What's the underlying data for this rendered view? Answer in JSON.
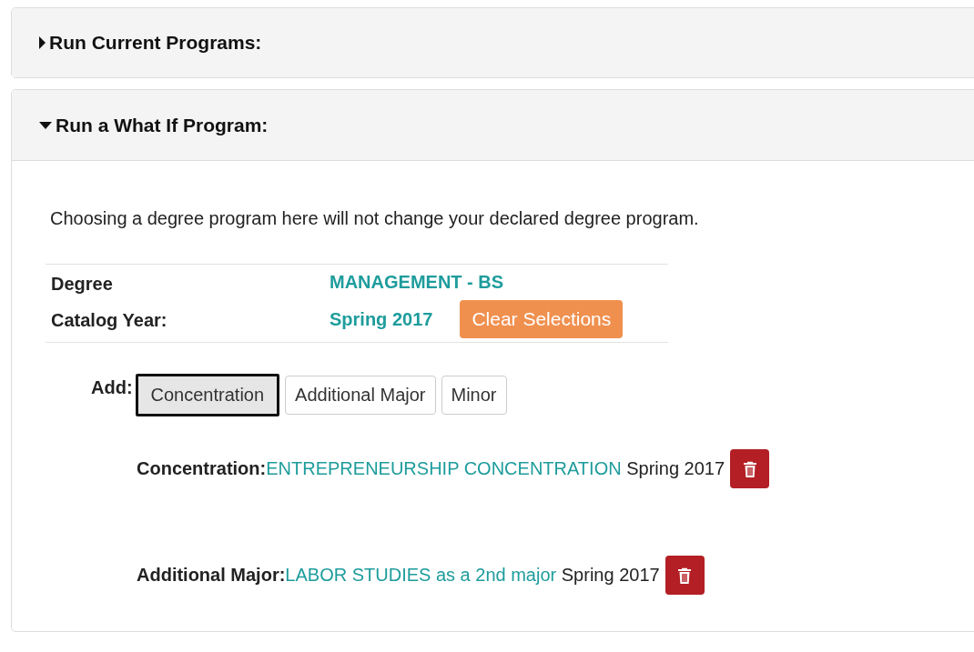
{
  "panels": [
    {
      "title": "Run Current Programs:",
      "expanded": false
    },
    {
      "title": "Run a What If Program:",
      "expanded": true,
      "content": {
        "notice": "Choosing a degree program here will not change your declared degree program.",
        "degree": {
          "label": "Degree",
          "value": "MANAGEMENT - BS"
        },
        "catalog_year": {
          "label": "Catalog Year:",
          "value": "Spring 2017"
        },
        "clear_button": "Clear Selections",
        "add": {
          "label": "Add:",
          "options": [
            {
              "label": "Concentration",
              "selected": true
            },
            {
              "label": "Additional Major",
              "selected": false
            },
            {
              "label": "Minor",
              "selected": false
            }
          ]
        },
        "selections": [
          {
            "label": "Concentration:",
            "program": "ENTREPRENEURSHIP CONCENTRATION",
            "term": "Spring 2017"
          },
          {
            "label": "Additional Major:",
            "program": "LABOR STUDIES as a 2nd major",
            "term": "Spring 2017"
          }
        ]
      }
    }
  ]
}
